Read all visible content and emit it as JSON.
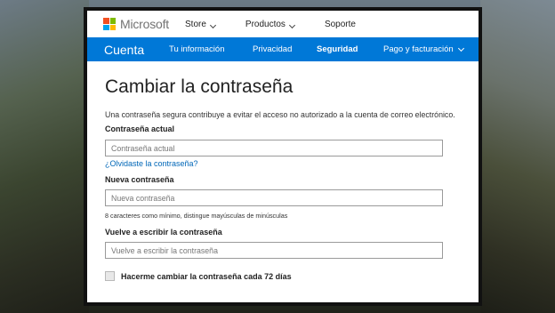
{
  "topbar": {
    "brand": "Microsoft",
    "nav": [
      {
        "label": "Store"
      },
      {
        "label": "Productos"
      },
      {
        "label": "Soporte"
      }
    ]
  },
  "account_nav": {
    "brand": "Cuenta",
    "items": [
      {
        "label": "Tu información"
      },
      {
        "label": "Privacidad"
      },
      {
        "label": "Seguridad"
      },
      {
        "label": "Pago y facturación"
      }
    ]
  },
  "form": {
    "title": "Cambiar la contraseña",
    "description": "Una contraseña segura contribuye a evitar el acceso no autorizado a la cuenta de correo electrónico.",
    "current_password": {
      "label": "Contraseña actual",
      "placeholder": "Contraseña actual",
      "value": ""
    },
    "forgot_link": "¿Olvidaste la contraseña?",
    "new_password": {
      "label": "Nueva contraseña",
      "placeholder": "Nueva contraseña",
      "value": ""
    },
    "new_password_hint": "8 caracteres como mínimo, distingue mayúsculas de minúsculas",
    "confirm_password": {
      "label": "Vuelve a escribir la contraseña",
      "placeholder": "Vuelve a escribir la contraseña",
      "value": ""
    },
    "expire_checkbox": {
      "label": "Hacerme cambiar la contraseña cada 72 días",
      "checked": false
    }
  },
  "colors": {
    "accent": "#0078d7",
    "link": "#0067b8",
    "logo": [
      "#f25022",
      "#7fba00",
      "#00a4ef",
      "#ffb900"
    ]
  }
}
